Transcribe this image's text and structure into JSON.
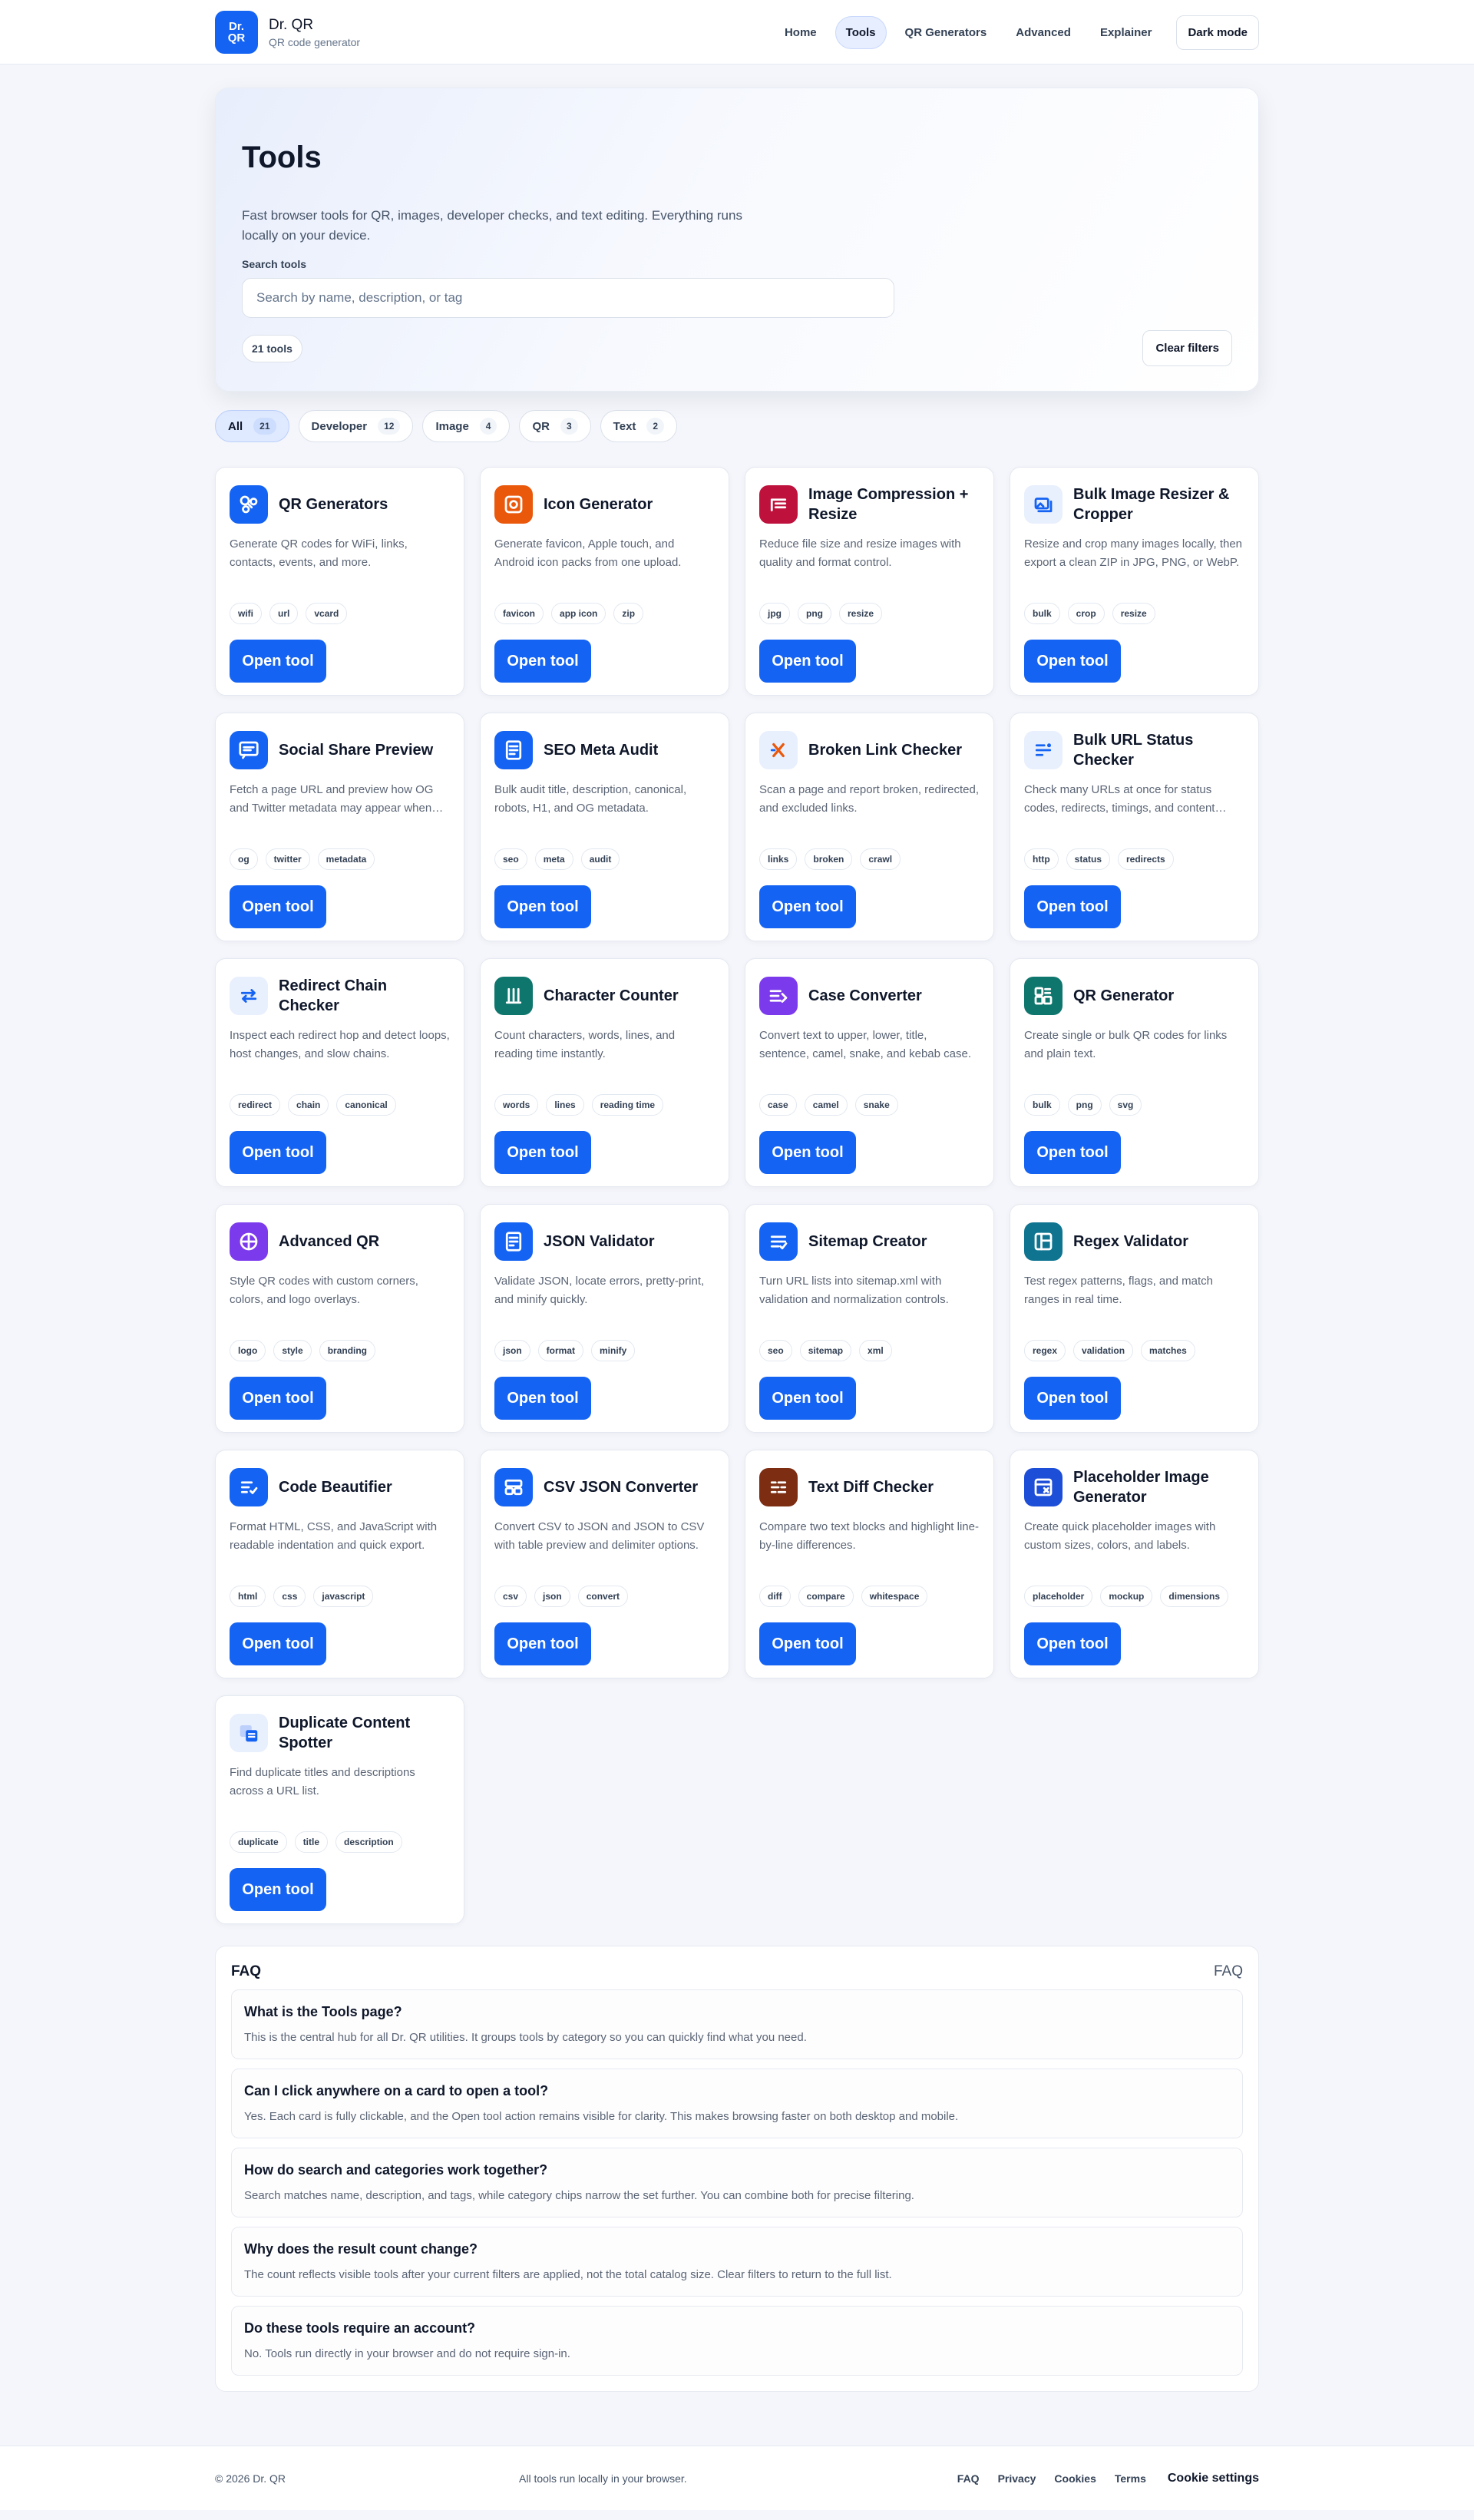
{
  "brand": {
    "logo_line1": "Dr.",
    "logo_line2": "QR",
    "name": "Dr. QR",
    "tagline": "QR code generator"
  },
  "nav": {
    "items": [
      {
        "label": "Home",
        "active": false
      },
      {
        "label": "Tools",
        "active": true
      },
      {
        "label": "QR Generators",
        "active": false
      },
      {
        "label": "Advanced",
        "active": false
      },
      {
        "label": "Explainer",
        "active": false
      }
    ],
    "dark_mode_label": "Dark mode"
  },
  "hero": {
    "title": "Tools",
    "description": "Fast browser tools for QR, images, developer checks, and text editing. Everything runs locally on your device.",
    "search_label": "Search tools",
    "search_placeholder": "Search by name, description, or tag",
    "search_value": "",
    "count_label": "21 tools",
    "clear_label": "Clear filters"
  },
  "categories": [
    {
      "label": "All",
      "count": "21",
      "active": true
    },
    {
      "label": "Developer",
      "count": "12",
      "active": false
    },
    {
      "label": "Image",
      "count": "4",
      "active": false
    },
    {
      "label": "QR",
      "count": "3",
      "active": false
    },
    {
      "label": "Text",
      "count": "2",
      "active": false
    }
  ],
  "open_label": "Open tool",
  "tools": [
    {
      "title": "QR Generators",
      "desc": "Generate QR codes for WiFi, links, contacts, events, and more.",
      "tags": [
        "wifi",
        "url",
        "vcard"
      ],
      "icon": "qr-nodes-icon",
      "color": "#1463f3"
    },
    {
      "title": "Icon Generator",
      "desc": "Generate favicon, Apple touch, and Android icon packs from one upload.",
      "tags": [
        "favicon",
        "app icon",
        "zip"
      ],
      "icon": "app-icon-icon",
      "color": "#ea580c"
    },
    {
      "title": "Image Compression + Resize",
      "desc": "Reduce file size and resize images with quality and format control.",
      "tags": [
        "jpg",
        "png",
        "resize"
      ],
      "icon": "compress-icon",
      "color": "#be123c"
    },
    {
      "title": "Bulk Image Resizer & Cropper",
      "desc": "Resize and crop many images locally, then export a clean ZIP in JPG, PNG, or WebP.",
      "tags": [
        "bulk",
        "crop",
        "resize"
      ],
      "icon": "image-resize-icon",
      "color": "#e8effd"
    },
    {
      "title": "Social Share Preview",
      "desc": "Fetch a page URL and preview how OG and Twitter metadata may appear when shared.",
      "tags": [
        "og",
        "twitter",
        "metadata"
      ],
      "icon": "share-preview-icon",
      "color": "#1463f3"
    },
    {
      "title": "SEO Meta Audit",
      "desc": "Bulk audit title, description, canonical, robots, H1, and OG metadata.",
      "tags": [
        "seo",
        "meta",
        "audit"
      ],
      "icon": "document-audit-icon",
      "color": "#1463f3"
    },
    {
      "title": "Broken Link Checker",
      "desc": "Scan a page and report broken, redirected, and excluded links.",
      "tags": [
        "links",
        "broken",
        "crawl"
      ],
      "icon": "broken-link-icon",
      "color": "#e8effd"
    },
    {
      "title": "Bulk URL Status Checker",
      "desc": "Check many URLs at once for status codes, redirects, timings, and content types.",
      "tags": [
        "http",
        "status",
        "redirects"
      ],
      "icon": "url-status-icon",
      "color": "#e8effd"
    },
    {
      "title": "Redirect Chain Checker",
      "desc": "Inspect each redirect hop and detect loops, host changes, and slow chains.",
      "tags": [
        "redirect",
        "chain",
        "canonical"
      ],
      "icon": "redirect-arrows-icon",
      "color": "#e8effd"
    },
    {
      "title": "Character Counter",
      "desc": "Count characters, words, lines, and reading time instantly.",
      "tags": [
        "words",
        "lines",
        "reading time"
      ],
      "icon": "counter-bars-icon",
      "color": "#0f766e"
    },
    {
      "title": "Case Converter",
      "desc": "Convert text to upper, lower, title, sentence, camel, snake, and kebab case.",
      "tags": [
        "case",
        "camel",
        "snake"
      ],
      "icon": "case-convert-icon",
      "color": "#7c3aed"
    },
    {
      "title": "QR Generator",
      "desc": "Create single or bulk QR codes for links and plain text.",
      "tags": [
        "bulk",
        "png",
        "svg"
      ],
      "icon": "qr-grid-icon",
      "color": "#0f766e"
    },
    {
      "title": "Advanced QR",
      "desc": "Style QR codes with custom corners, colors, and logo overlays.",
      "tags": [
        "logo",
        "style",
        "branding"
      ],
      "icon": "advanced-qr-icon",
      "color": "#7c3aed"
    },
    {
      "title": "JSON Validator",
      "desc": "Validate JSON, locate errors, pretty-print, and minify quickly.",
      "tags": [
        "json",
        "format",
        "minify"
      ],
      "icon": "json-doc-icon",
      "color": "#1463f3"
    },
    {
      "title": "Sitemap Creator",
      "desc": "Turn URL lists into sitemap.xml with validation and normalization controls.",
      "tags": [
        "seo",
        "sitemap",
        "xml"
      ],
      "icon": "sitemap-list-icon",
      "color": "#1463f3"
    },
    {
      "title": "Regex Validator",
      "desc": "Test regex patterns, flags, and match ranges in real time.",
      "tags": [
        "regex",
        "validation",
        "matches"
      ],
      "icon": "regex-panel-icon",
      "color": "#0e7490"
    },
    {
      "title": "Code Beautifier",
      "desc": "Format HTML, CSS, and JavaScript with readable indentation and quick export.",
      "tags": [
        "html",
        "css",
        "javascript"
      ],
      "icon": "code-format-icon",
      "color": "#1463f3"
    },
    {
      "title": "CSV JSON Converter",
      "desc": "Convert CSV to JSON and JSON to CSV with table preview and delimiter options.",
      "tags": [
        "csv",
        "json",
        "convert"
      ],
      "icon": "csv-table-icon",
      "color": "#1463f3"
    },
    {
      "title": "Text Diff Checker",
      "desc": "Compare two text blocks and highlight line-by-line differences.",
      "tags": [
        "diff",
        "compare",
        "whitespace"
      ],
      "icon": "text-diff-icon",
      "color": "#7c2d12"
    },
    {
      "title": "Placeholder Image Generator",
      "desc": "Create quick placeholder images with custom sizes, colors, and labels.",
      "tags": [
        "placeholder",
        "mockup",
        "dimensions"
      ],
      "icon": "placeholder-image-icon",
      "color": "#1d4ed8"
    },
    {
      "title": "Duplicate Content Spotter",
      "desc": "Find duplicate titles and descriptions across a URL list.",
      "tags": [
        "duplicate",
        "title",
        "description"
      ],
      "icon": "duplicate-docs-icon",
      "color": "#e8effd"
    }
  ],
  "faq": {
    "title": "FAQ",
    "tag": "FAQ",
    "items": [
      {
        "q": "What is the Tools page?",
        "a": "This is the central hub for all Dr. QR utilities. It groups tools by category so you can quickly find what you need."
      },
      {
        "q": "Can I click anywhere on a card to open a tool?",
        "a": "Yes. Each card is fully clickable, and the Open tool action remains visible for clarity. This makes browsing faster on both desktop and mobile."
      },
      {
        "q": "How do search and categories work together?",
        "a": "Search matches name, description, and tags, while category chips narrow the set further. You can combine both for precise filtering."
      },
      {
        "q": "Why does the result count change?",
        "a": "The count reflects visible tools after your current filters are applied, not the total catalog size. Clear filters to return to the full list."
      },
      {
        "q": "Do these tools require an account?",
        "a": "No. Tools run directly in your browser and do not require sign-in."
      }
    ]
  },
  "footer": {
    "copyright": "© 2026 Dr. QR",
    "note": "All tools run locally in your browser.",
    "links": [
      "FAQ",
      "Privacy",
      "Cookies",
      "Terms"
    ],
    "cookie_settings": "Cookie settings"
  }
}
